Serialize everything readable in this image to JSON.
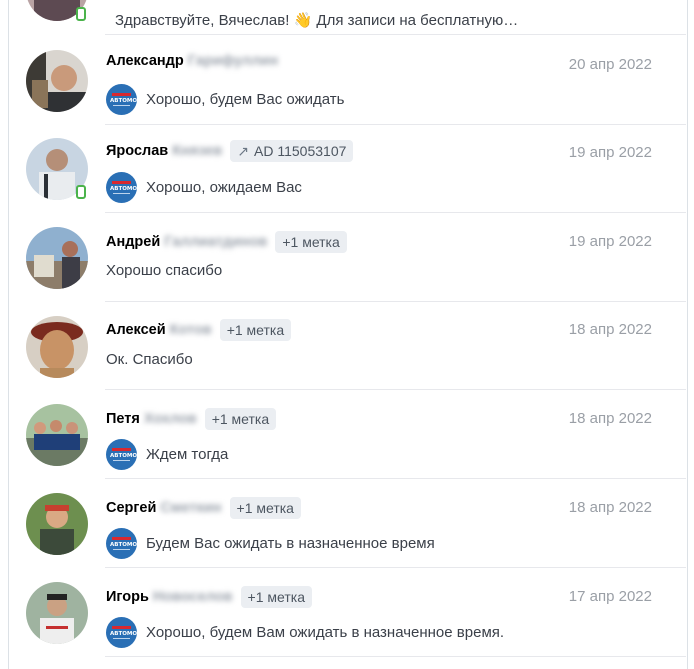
{
  "rows": [
    {
      "first_name": "",
      "last_name_blurred": "",
      "date": "",
      "has_logo": true,
      "online": true,
      "message": "Здравствуйте, Вячеслав! 👋 Для записи на бесплатную…"
    },
    {
      "first_name": "Александр",
      "last_name_blurred": "Гарифуллин",
      "tag": "",
      "date": "20 апр 2022",
      "has_logo": true,
      "message": "Хорошо, будем Вас ожидать"
    },
    {
      "first_name": "Ярослав",
      "last_name_blurred": "Князев",
      "tag": "AD 115053107",
      "tag_icon": "arrow-up-right-icon",
      "date": "19 апр 2022",
      "has_logo": true,
      "online": true,
      "message": "Хорошо, ожидаем Вас"
    },
    {
      "first_name": "Андрей",
      "last_name_blurred": "Галлиатдинов",
      "tag": "+1 метка",
      "date": "19 апр 2022",
      "has_logo": false,
      "message": "Хорошо спасибо"
    },
    {
      "first_name": "Алексей",
      "last_name_blurred": "Котов",
      "tag": "+1 метка",
      "date": "18 апр 2022",
      "has_logo": false,
      "message": "Ок. Спасибо"
    },
    {
      "first_name": "Петя",
      "last_name_blurred": "Хохлов",
      "tag": "+1 метка",
      "date": "18 апр 2022",
      "has_logo": true,
      "message": "Ждем тогда"
    },
    {
      "first_name": "Сергей",
      "last_name_blurred": "Сметкин",
      "tag": "+1 метка",
      "date": "18 апр 2022",
      "has_logo": true,
      "message": "Будем Вас ожидать в назначенное время"
    },
    {
      "first_name": "Игорь",
      "last_name_blurred": "Новоселов",
      "tag": "+1 метка",
      "date": "17 апр 2022",
      "has_logo": true,
      "message": "Хорошо, будем Вам ожидать в назначенное время."
    }
  ],
  "logo_text": "АВТОМОЙ",
  "colors": {
    "separator": "#e7e8ec",
    "date": "#9a9fa6",
    "tag_bg": "#ebeef2",
    "logo_blue": "#2a6fb5",
    "online": "#4bb34b"
  }
}
